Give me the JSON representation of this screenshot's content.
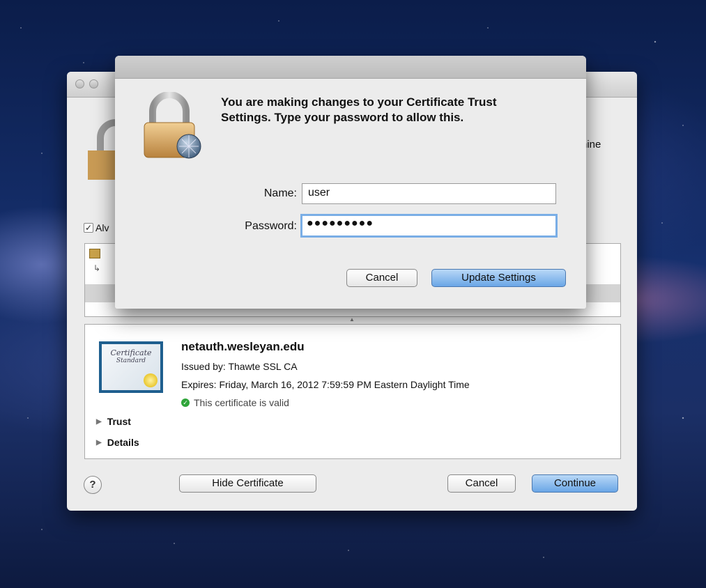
{
  "auth_sheet": {
    "message": "You are making changes to your Certificate Trust Settings. Type your password to allow this.",
    "name_label": "Name:",
    "name_value": "user",
    "password_label": "Password:",
    "password_value": "●●●●●●●●●",
    "cancel_label": "Cancel",
    "update_label": "Update Settings"
  },
  "trust_window": {
    "cut_text": "nine",
    "always_trust_label": "Alv",
    "certificate": {
      "name": "netauth.wesleyan.edu",
      "issued_by": "Issued by: Thawte SSL CA",
      "expires": "Expires: Friday, March 16, 2012 7:59:59 PM Eastern Daylight Time",
      "status": "This certificate is valid",
      "image_text_1": "Certificate",
      "image_text_2": "Standard"
    },
    "disclosures": [
      "Trust",
      "Details"
    ],
    "help_label": "?",
    "hide_certificate_label": "Hide Certificate",
    "cancel_label": "Cancel",
    "continue_label": "Continue"
  },
  "colors": {
    "primary_button": "#6aa6e6",
    "valid_icon": "#2fa53a",
    "focus_ring": "#7aaee6"
  }
}
